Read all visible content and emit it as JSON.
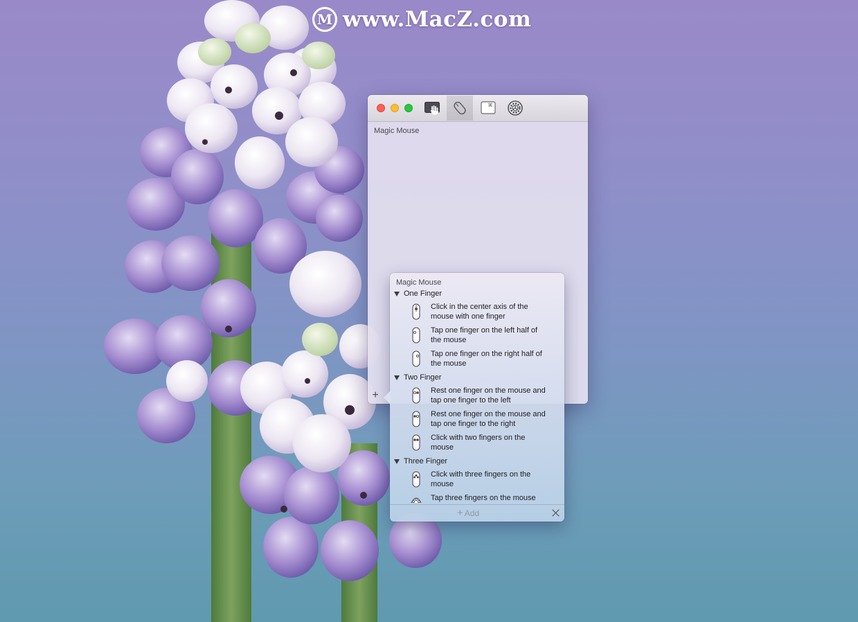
{
  "watermark": {
    "logo_letter": "M",
    "text": "www.MacZ.com"
  },
  "window": {
    "toolbar": [
      {
        "icon": "trackpad-hand-icon",
        "selected": false
      },
      {
        "icon": "magic-mouse-icon",
        "selected": true
      },
      {
        "icon": "keyboard-shortcut-icon",
        "selected": false
      },
      {
        "icon": "gear-icon",
        "selected": false
      }
    ],
    "section_title": "Magic Mouse",
    "add_symbol": "+"
  },
  "popover": {
    "title": "Magic Mouse",
    "groups": [
      {
        "label": "One Finger",
        "items": [
          {
            "icon": "mouse-center-click-icon",
            "label": "Click in the center axis of the\nmouse with one finger"
          },
          {
            "icon": "mouse-left-tap-icon",
            "label": "Tap one finger on the left half of\nthe mouse"
          },
          {
            "icon": "mouse-right-tap-icon",
            "label": "Tap one finger on the right half of\nthe mouse"
          }
        ]
      },
      {
        "label": "Two Finger",
        "items": [
          {
            "icon": "mouse-rest-tap-left-icon",
            "label": "Rest one finger on the mouse and\ntap one finger to the left"
          },
          {
            "icon": "mouse-rest-tap-right-icon",
            "label": "Rest one finger on the mouse and\ntap one finger to the right"
          },
          {
            "icon": "mouse-two-finger-click-icon",
            "label": "Click with two fingers on the\nmouse"
          }
        ]
      },
      {
        "label": "Three Finger",
        "items": [
          {
            "icon": "mouse-three-finger-click-icon",
            "label": "Click with three fingers on the\nmouse"
          },
          {
            "icon": "mouse-three-finger-tap-icon",
            "label": "Tap three fingers on the mouse"
          }
        ]
      }
    ],
    "footer": {
      "add_label": "Add",
      "add_symbol": "+"
    }
  }
}
